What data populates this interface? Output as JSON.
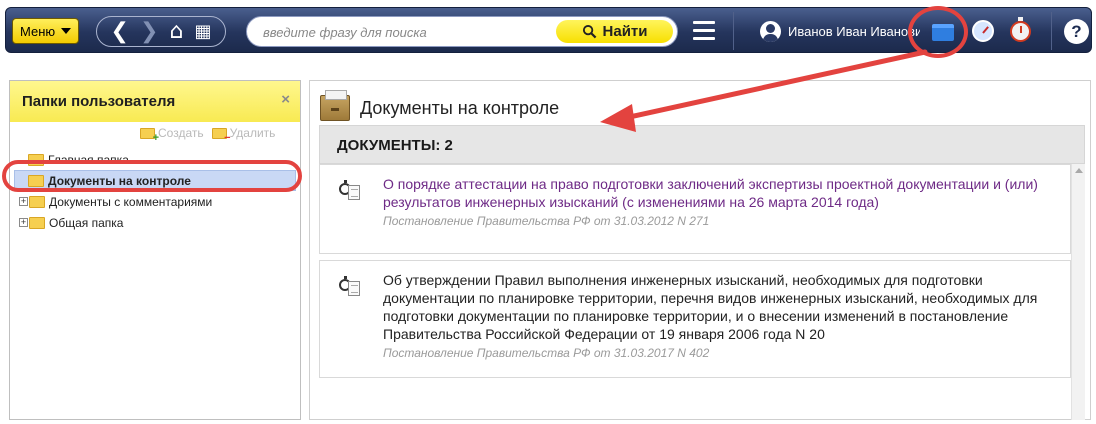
{
  "toolbar": {
    "menu_label": "Меню",
    "search_placeholder": "введите фразу для поиска",
    "find_label": "Найти",
    "user_name": "Иванов Иван Иванович",
    "help_label": "?"
  },
  "icons": {
    "back": "chevron-left-icon",
    "forward": "chevron-right-icon",
    "home": "home-icon",
    "grid": "grid-icon",
    "menu": "hamburger-icon",
    "user": "user-icon",
    "folder": "folder-icon",
    "history": "clock-icon",
    "control": "stopwatch-icon",
    "help": "help-icon"
  },
  "colors": {
    "toolbar_bg": "#25355d",
    "accent_yellow": "#f7df00",
    "highlight_red": "#e3433f",
    "selected_row": "#c9d8f5",
    "visited_link": "#6e2a86"
  },
  "left_panel": {
    "title": "Папки пользователя",
    "close_label": "×",
    "create_label": "Создать",
    "delete_label": "Удалить",
    "tree": [
      {
        "label": "Главная папка",
        "expandable": false,
        "selected": false
      },
      {
        "label": "Документы на контроле",
        "expandable": false,
        "selected": true
      },
      {
        "label": "Документы с комментариями",
        "expandable": true,
        "selected": false
      },
      {
        "label": "Общая папка",
        "expandable": true,
        "selected": false
      }
    ]
  },
  "right_panel": {
    "title": "Документы на контроле",
    "docs_header": "ДОКУМЕНТЫ: 2",
    "documents": [
      {
        "title": "О порядке аттестации на право подготовки заключений экспертизы проектной документации и (или) результатов инженерных изысканий (с изменениями на 26 марта 2014 года)",
        "source": "Постановление Правительства РФ от 31.03.2012 N 271",
        "visited": true
      },
      {
        "title": "Об утверждении Правил выполнения инженерных изысканий, необходимых для подготовки документации по планировке территории, перечня видов инженерных изысканий, необходимых для подготовки документации по планировке территории, и о внесении изменений в постановление Правительства Российской Федерации от 19 января 2006 года N 20",
        "source": "Постановление Правительства РФ от 31.03.2017 N 402",
        "visited": false
      }
    ]
  }
}
